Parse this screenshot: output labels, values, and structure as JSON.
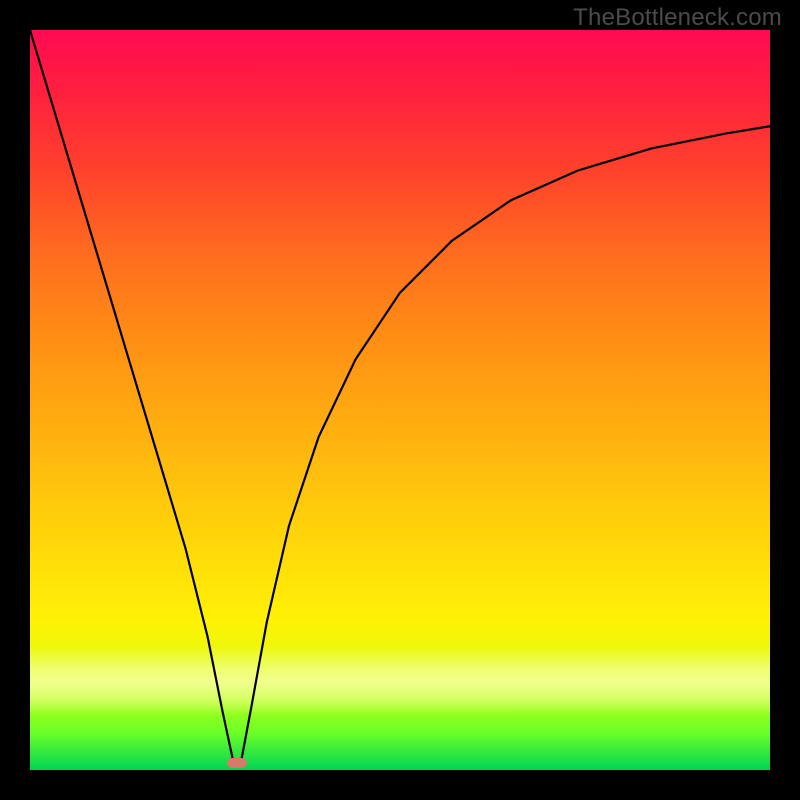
{
  "watermark": "TheBottleneck.com",
  "chart_data": {
    "type": "line",
    "title": "",
    "xlabel": "",
    "ylabel": "",
    "xlim": [
      0,
      1
    ],
    "ylim": [
      0,
      1
    ],
    "grid": false,
    "legend": false,
    "background": {
      "kind": "vertical-gradient",
      "stops": [
        {
          "pos": 0.0,
          "color": "#ff0a53"
        },
        {
          "pos": 0.08,
          "color": "#ff1f3f"
        },
        {
          "pos": 0.18,
          "color": "#ff3e2d"
        },
        {
          "pos": 0.3,
          "color": "#ff6b1f"
        },
        {
          "pos": 0.42,
          "color": "#ff8f14"
        },
        {
          "pos": 0.55,
          "color": "#ffb20f"
        },
        {
          "pos": 0.68,
          "color": "#ffd40a"
        },
        {
          "pos": 0.8,
          "color": "#fff206"
        },
        {
          "pos": 0.88,
          "color": "#d6ff0a"
        },
        {
          "pos": 0.95,
          "color": "#6aff28"
        },
        {
          "pos": 1.0,
          "color": "#00d455"
        }
      ],
      "highlight_band": {
        "y_center": 0.12,
        "height": 0.1,
        "color": "#ffffcc"
      }
    },
    "series": [
      {
        "name": "left-branch",
        "color": "#000000",
        "x": [
          0.0,
          0.03,
          0.06,
          0.09,
          0.12,
          0.15,
          0.18,
          0.21,
          0.24,
          0.26,
          0.275
        ],
        "y": [
          1.0,
          0.9,
          0.8,
          0.7,
          0.6,
          0.5,
          0.4,
          0.3,
          0.18,
          0.08,
          0.01
        ]
      },
      {
        "name": "right-branch",
        "color": "#000000",
        "x": [
          0.285,
          0.3,
          0.32,
          0.35,
          0.39,
          0.44,
          0.5,
          0.57,
          0.65,
          0.74,
          0.84,
          0.94,
          1.0
        ],
        "y": [
          0.01,
          0.09,
          0.2,
          0.33,
          0.45,
          0.555,
          0.645,
          0.715,
          0.77,
          0.81,
          0.84,
          0.86,
          0.87
        ]
      }
    ],
    "marker": {
      "x": 0.28,
      "y": 0.01,
      "color": "#d87a6a",
      "shape": "pill"
    }
  }
}
